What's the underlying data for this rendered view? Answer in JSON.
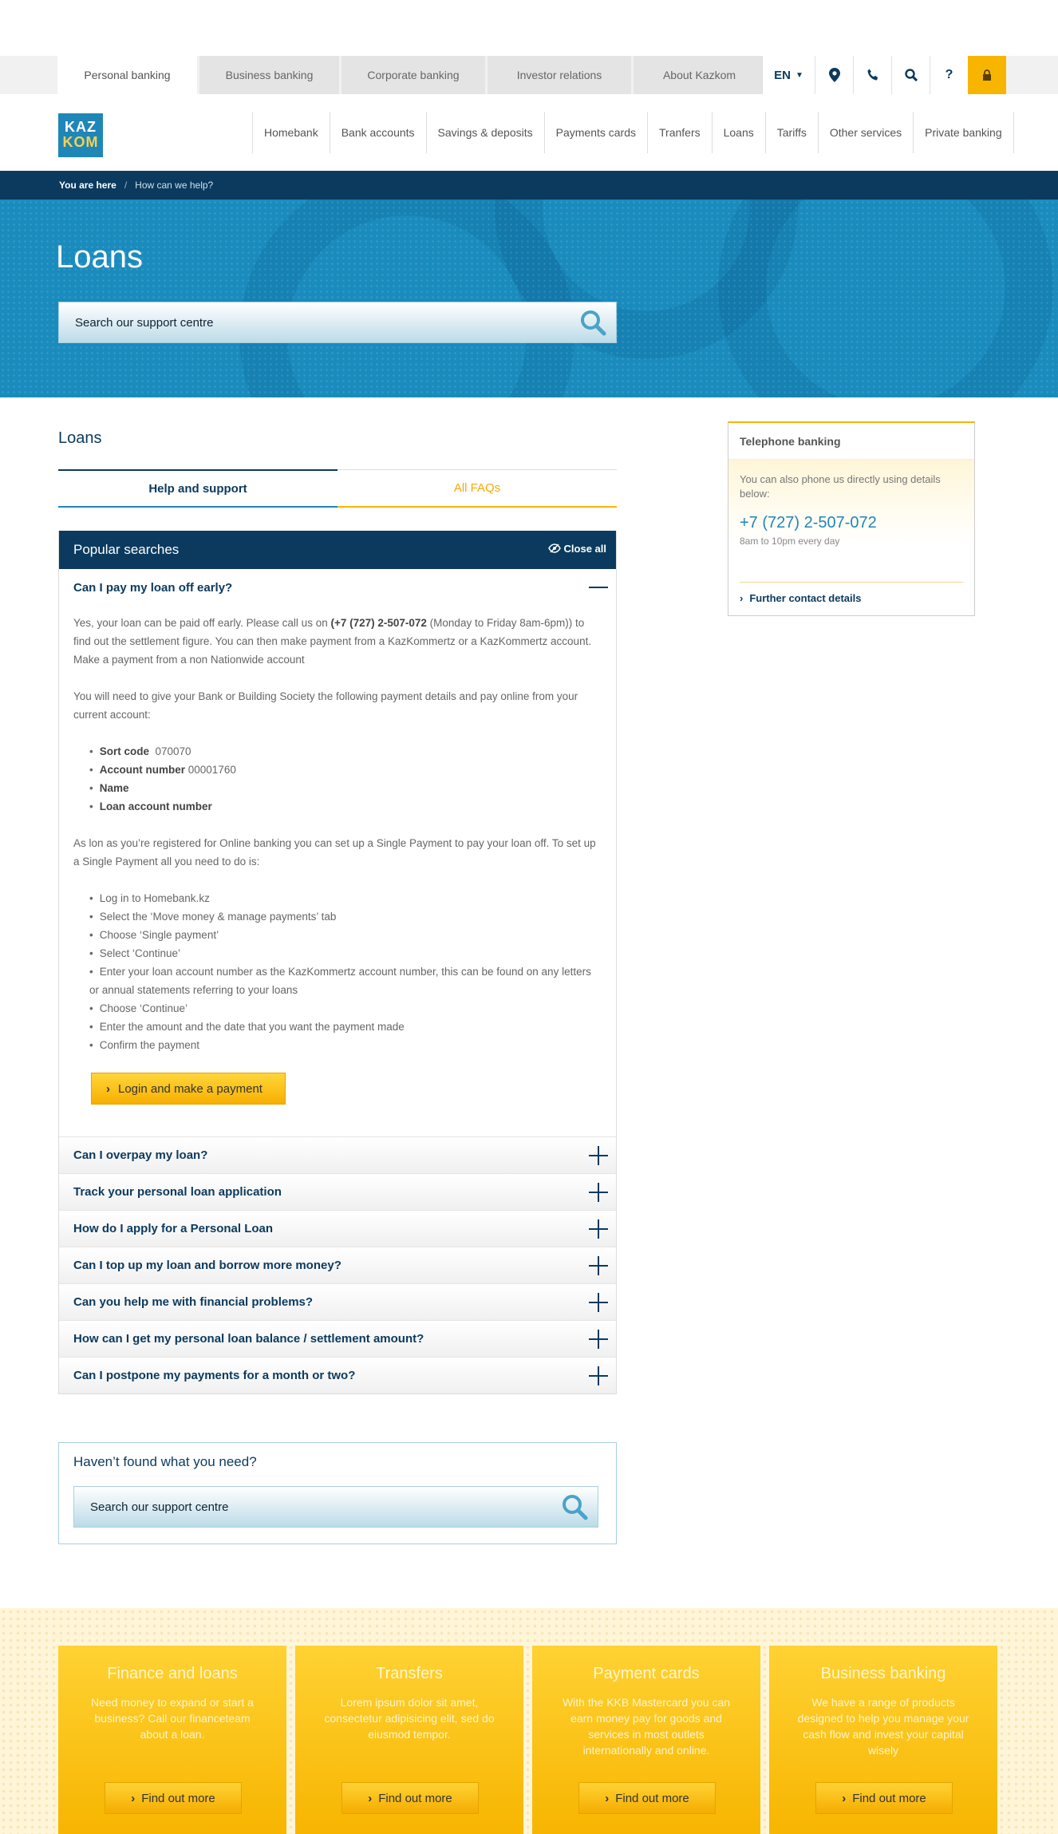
{
  "topnav": {
    "tabs": [
      "Personal banking",
      "Business banking",
      "Corporate banking",
      "Investor relations",
      "About Kazkom"
    ],
    "lang": "EN"
  },
  "logo": {
    "line1": "KAZ",
    "line2": "KOM"
  },
  "mainnav": [
    "Homebank",
    "Bank accounts",
    "Savings & deposits",
    "Payments cards",
    "Tranfers",
    "Loans",
    "Tariffs",
    "Other services",
    "Private banking"
  ],
  "breadcrumb": {
    "label": "You are here",
    "sep": "/",
    "current": "How can we help?"
  },
  "hero": {
    "title": "Loans",
    "search_placeholder": "Search our support centre"
  },
  "section": {
    "title": "Loans"
  },
  "tabs": {
    "help": "Help and support",
    "faqs": "All FAQs"
  },
  "accordion": {
    "title": "Popular searches",
    "close_all": "Close all",
    "open_question": "Can I pay my loan off early?",
    "answer": {
      "p1_a": "Yes, your loan can be paid off early. Please call us on ",
      "p1_phone": "(+7 (727) 2-507-072",
      "p1_b": " (Monday to Friday 8am-6pm)) to find out the settlement figure. You can then make payment from a KazKommertz or a KazKommertz account.",
      "p1_c": "Make a payment from a non Nationwide account",
      "p2": "You will need to give your Bank or Building Society the following payment details and pay online from your current account:",
      "details": [
        {
          "label": "Sort code",
          "value": "070070"
        },
        {
          "label": "Account number",
          "value": "00001760"
        },
        {
          "label": "Name",
          "value": ""
        },
        {
          "label": "Loan account number",
          "value": ""
        }
      ],
      "p3": "As lon as you’re registered for Online banking you can set up a Single Payment to pay your loan off. To set up a Single Payment all you need to do is:",
      "steps": [
        "Log in to Homebank.kz",
        "Select the ‘Move money & manage payments’ tab",
        "Choose ‘Single payment’",
        "Select ‘Continue’",
        "Enter your loan account number as the KazKommertz account number, this can be found on any letters or annual statements referring to your loans",
        "Choose ‘Continue’",
        "Enter the amount and the date that you want the payment made",
        "Confirm the payment"
      ],
      "button": "Login and make a payment"
    },
    "questions": [
      "Can I overpay my loan?",
      "Track your personal loan application",
      "How do I apply for a Personal Loan",
      "Can I top up my loan and borrow more money?",
      "Can you help me with financial problems?",
      "How can I get my personal loan balance / settlement amount?",
      "Can I postpone my payments for a month or two?"
    ]
  },
  "notfound": {
    "title": "Haven’t found what you need?",
    "search_placeholder": "Search our support centre"
  },
  "sidebar": {
    "title": "Telephone banking",
    "text": "You can also phone us directly using details below:",
    "phone": "+7 (727) 2-507-072",
    "hours": "8am to 10pm every day",
    "link": "Further contact details"
  },
  "footer": {
    "cards": [
      {
        "title": "Finance and loans",
        "text": "Need money to expand or start a business? Call our financeteam about a loan.",
        "button": "Find out more"
      },
      {
        "title": "Transfers",
        "text": "Lorem ipsum dolor sit amet, consectetur adipisicing elit, sed do eiusmod tempor.",
        "button": "Find out more"
      },
      {
        "title": "Payment cards",
        "text": "With the KKB Mastercard you can earn money pay for goods and services in most outlets internationally and online.",
        "button": "Find out more"
      },
      {
        "title": "Business banking",
        "text": "We have a range of products designed to help you manage your cash flow and invest your capital wisely",
        "button": "Find out more"
      }
    ]
  },
  "colors": {
    "navy": "#0b3a5e",
    "blue": "#1a8bbd",
    "yellow": "#f7b500"
  }
}
